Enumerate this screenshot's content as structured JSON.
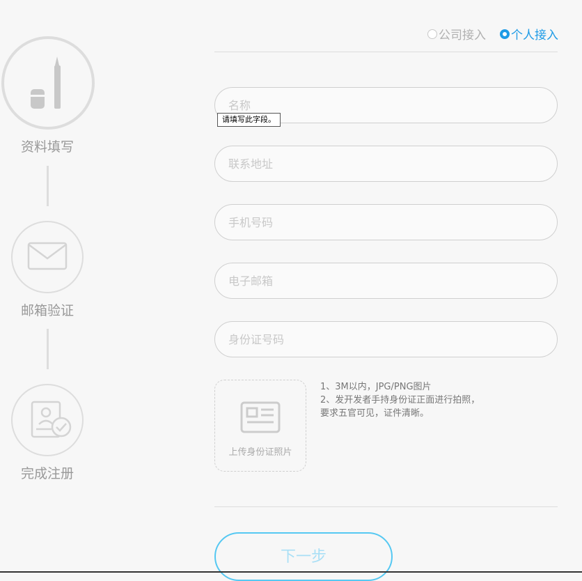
{
  "steps": [
    {
      "label": "资料填写",
      "icon": "pen-icon"
    },
    {
      "label": "邮箱验证",
      "icon": "envelope-icon"
    },
    {
      "label": "完成注册",
      "icon": "id-check-icon"
    }
  ],
  "access_type": {
    "options": [
      {
        "label": "公司接入",
        "checked": false
      },
      {
        "label": "个人接入",
        "checked": true
      }
    ],
    "accent_color": "#1e9be6"
  },
  "form": {
    "name_placeholder": "名称",
    "address_placeholder": "联系地址",
    "phone_placeholder": "手机号码",
    "email_placeholder": "电子邮箱",
    "idnumber_placeholder": "身份证号码",
    "validation_tooltip": "请填写此字段。"
  },
  "upload": {
    "label": "上传身份证照片",
    "icon": "id-card-icon",
    "hints": [
      "1、3M以内，JPG/PNG图片",
      "2、发开发者手持身份证正面进行拍照，",
      "要求五官可见，证件清晰。"
    ]
  },
  "next_label": "下一步"
}
